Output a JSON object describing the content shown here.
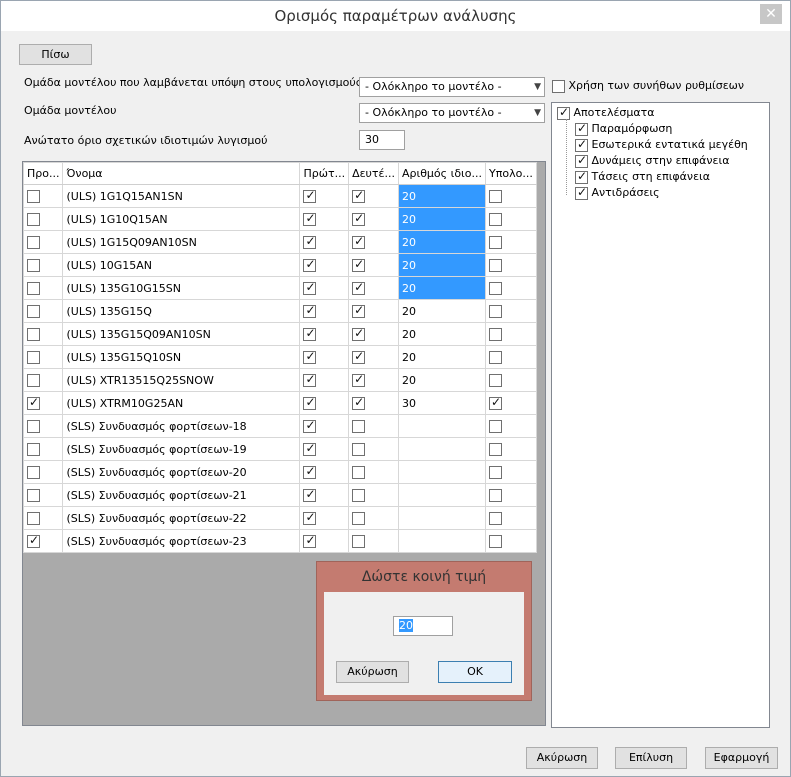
{
  "window": {
    "title": "Ορισμός παραμέτρων ανάλυσης",
    "close_glyph": "✕"
  },
  "back_label": "Πίσω",
  "form": {
    "group_calc_label": "Ομάδα μοντέλου που λαμβάνεται υπόψη στους υπολογισμούς",
    "group_calc_value": "- Ολόκληρο το μοντέλο -",
    "group_label": "Ομάδα μοντέλου",
    "group_value": "- Ολόκληρο το μοντέλο -",
    "eigen_label": "Ανώτατο όριο σχετικών ιδιοτιμών λυγισμού",
    "eigen_value": "30",
    "use_defaults_label": "Χρήση των συνήθων ρυθμίσεων",
    "use_defaults_checked": false
  },
  "grid": {
    "headers": [
      "Προ...",
      "Όνομα",
      "Πρώτ...",
      "Δευτέ...",
      "Αριθμός ιδιο...",
      "Υπολο..."
    ],
    "rows": [
      {
        "pro": false,
        "name": "(ULS) 1G1Q15AN1SN",
        "first": true,
        "second": true,
        "num": "20",
        "sel": true,
        "calc": false
      },
      {
        "pro": false,
        "name": "(ULS) 1G10Q15AN",
        "first": true,
        "second": true,
        "num": "20",
        "sel": true,
        "calc": false
      },
      {
        "pro": false,
        "name": "(ULS) 1G15Q09AN10SN",
        "first": true,
        "second": true,
        "num": "20",
        "sel": true,
        "calc": false
      },
      {
        "pro": false,
        "name": "(ULS) 10G15AN",
        "first": true,
        "second": true,
        "num": "20",
        "sel": true,
        "calc": false
      },
      {
        "pro": false,
        "name": "(ULS) 135G10G15SN",
        "first": true,
        "second": true,
        "num": "20",
        "sel": true,
        "calc": false
      },
      {
        "pro": false,
        "name": "(ULS) 135G15Q",
        "first": true,
        "second": true,
        "num": "20",
        "sel": false,
        "calc": false
      },
      {
        "pro": false,
        "name": "(ULS) 135G15Q09AN10SN",
        "first": true,
        "second": true,
        "num": "20",
        "sel": false,
        "calc": false
      },
      {
        "pro": false,
        "name": "(ULS) 135G15Q10SN",
        "first": true,
        "second": true,
        "num": "20",
        "sel": false,
        "calc": false
      },
      {
        "pro": false,
        "name": "(ULS) XTR13515Q25SNOW",
        "first": true,
        "second": true,
        "num": "20",
        "sel": false,
        "calc": false
      },
      {
        "pro": true,
        "name": "(ULS) XTRM10G25AN",
        "first": true,
        "second": true,
        "num": "30",
        "sel": false,
        "calc": true
      },
      {
        "pro": false,
        "name": "(SLS) Συνδυασμός φορτίσεων-18",
        "first": true,
        "second": false,
        "num": "",
        "sel": false,
        "calc": false
      },
      {
        "pro": false,
        "name": "(SLS) Συνδυασμός φορτίσεων-19",
        "first": true,
        "second": false,
        "num": "",
        "sel": false,
        "calc": false
      },
      {
        "pro": false,
        "name": "(SLS) Συνδυασμός φορτίσεων-20",
        "first": true,
        "second": false,
        "num": "",
        "sel": false,
        "calc": false
      },
      {
        "pro": false,
        "name": "(SLS) Συνδυασμός φορτίσεων-21",
        "first": true,
        "second": false,
        "num": "",
        "sel": false,
        "calc": false
      },
      {
        "pro": false,
        "name": "(SLS) Συνδυασμός φορτίσεων-22",
        "first": true,
        "second": false,
        "num": "",
        "sel": false,
        "calc": false
      },
      {
        "pro": true,
        "name": "(SLS) Συνδυασμός φορτίσεων-23",
        "first": true,
        "second": false,
        "num": "",
        "sel": false,
        "calc": false
      }
    ]
  },
  "tree": {
    "root": {
      "label": "Αποτελέσματα",
      "checked": true
    },
    "children": [
      {
        "label": "Παραμόρφωση",
        "checked": true
      },
      {
        "label": "Εσωτερικά εντατικά μεγέθη",
        "checked": true
      },
      {
        "label": "Δυνάμεις στην επιφάνεια",
        "checked": true
      },
      {
        "label": "Τάσεις στη επιφάνεια",
        "checked": true
      },
      {
        "label": "Αντιδράσεις",
        "checked": true
      }
    ]
  },
  "dialog": {
    "title": "Δώστε κοινή τιμή",
    "value": "20",
    "cancel_label": "Ακύρωση",
    "ok_label": "OK"
  },
  "footer": {
    "cancel_label": "Ακύρωση",
    "solve_label": "Επίλυση",
    "apply_label": "Εφαρμογή"
  }
}
